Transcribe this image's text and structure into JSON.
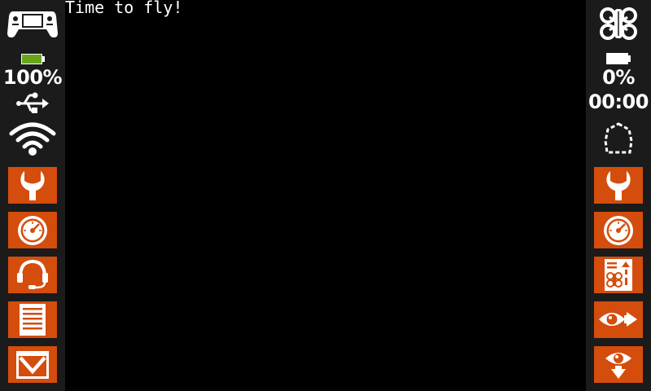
{
  "log": {
    "lines": [
      "Time to fly!"
    ]
  },
  "radio": {
    "battery_percent_label": "100%",
    "battery_level": 1.0,
    "connection_icon": "usb-icon",
    "wifi_icon": "wifi-icon"
  },
  "drone": {
    "battery_percent_label": "0%",
    "battery_level": 0.0,
    "flight_time": "00:00",
    "link_icon": "drone-icon",
    "gps_icon": "geofence-icon"
  },
  "left_buttons": [
    {
      "icon": "wrench-icon"
    },
    {
      "icon": "gauge-icon"
    },
    {
      "icon": "headset-icon"
    },
    {
      "icon": "log-document-icon"
    },
    {
      "icon": "email-icon"
    }
  ],
  "right_buttons": [
    {
      "icon": "wrench-icon"
    },
    {
      "icon": "gauge-icon"
    },
    {
      "icon": "flight-log-icon"
    },
    {
      "icon": "eye-forward-icon"
    },
    {
      "icon": "eye-down-icon"
    }
  ],
  "colors": {
    "accent": "#d44d0d",
    "sidebar": "#1b1b1b",
    "background": "#000000",
    "battery_green": "#6aa41e",
    "foreground": "#ffffff"
  }
}
